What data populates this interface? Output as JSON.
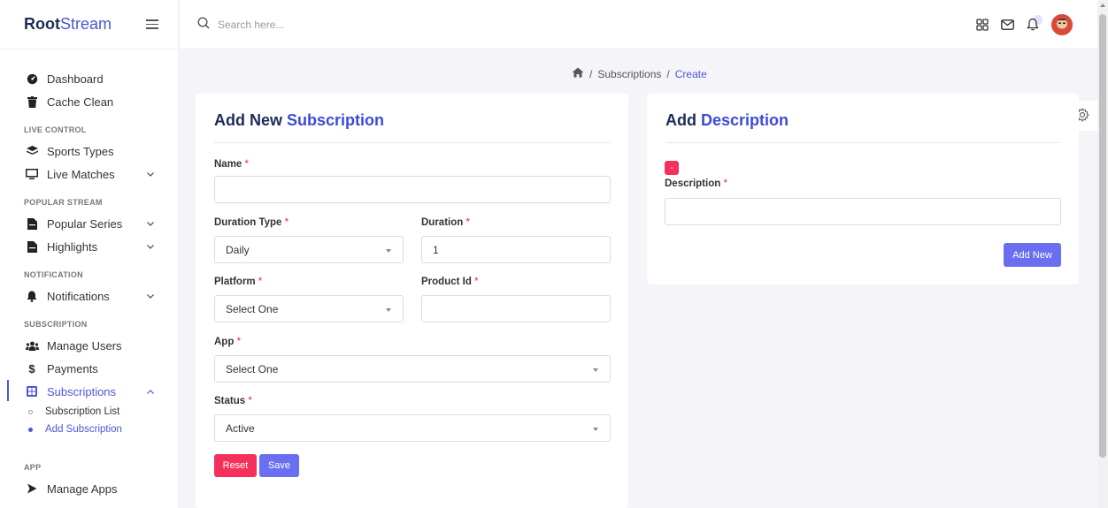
{
  "brand": {
    "part1": "Root",
    "part2": "Stream"
  },
  "search": {
    "placeholder": "Search here..."
  },
  "sidebar": {
    "top_items": [
      {
        "label": "Dashboard",
        "icon": "dashboard-icon"
      },
      {
        "label": "Cache Clean",
        "icon": "trash-icon"
      }
    ],
    "sections": {
      "live_control": "LIVE CONTROL",
      "popular_stream": "POPULAR STREAM",
      "notification": "NOTIFICATION",
      "subscription": "SUBSCRIPTION",
      "app": "APP"
    },
    "items": {
      "sports_types": "Sports Types",
      "live_matches": "Live Matches",
      "popular_series": "Popular Series",
      "highlights": "Highlights",
      "notifications": "Notifications",
      "manage_users": "Manage Users",
      "payments": "Payments",
      "subscriptions": "Subscriptions",
      "subscription_list": "Subscription List",
      "add_subscription": "Add Subscription",
      "manage_apps": "Manage Apps"
    }
  },
  "breadcrumb": {
    "sep": "/",
    "level1": "Subscriptions",
    "level2": "Create"
  },
  "form": {
    "title_part1": "Add New",
    "title_part2": "Subscription",
    "name_label": "Name",
    "name_value": "",
    "duration_type_label": "Duration Type",
    "duration_type_value": "Daily",
    "duration_label": "Duration",
    "duration_value": "1",
    "platform_label": "Platform",
    "platform_value": "Select One",
    "product_id_label": "Product Id",
    "product_id_value": "",
    "app_label": "App",
    "app_value": "Select One",
    "status_label": "Status",
    "status_value": "Active",
    "required_mark": "*",
    "reset_label": "Reset",
    "save_label": "Save"
  },
  "description": {
    "title_part1": "Add",
    "title_part2": "Description",
    "minus_label": "-",
    "label": "Description",
    "value": "",
    "add_new_label": "Add New"
  },
  "colors": {
    "accent": "#4a57d6",
    "title_dark": "#1d2b55",
    "danger": "#f5305a",
    "primary_button": "#6a6ff1"
  }
}
